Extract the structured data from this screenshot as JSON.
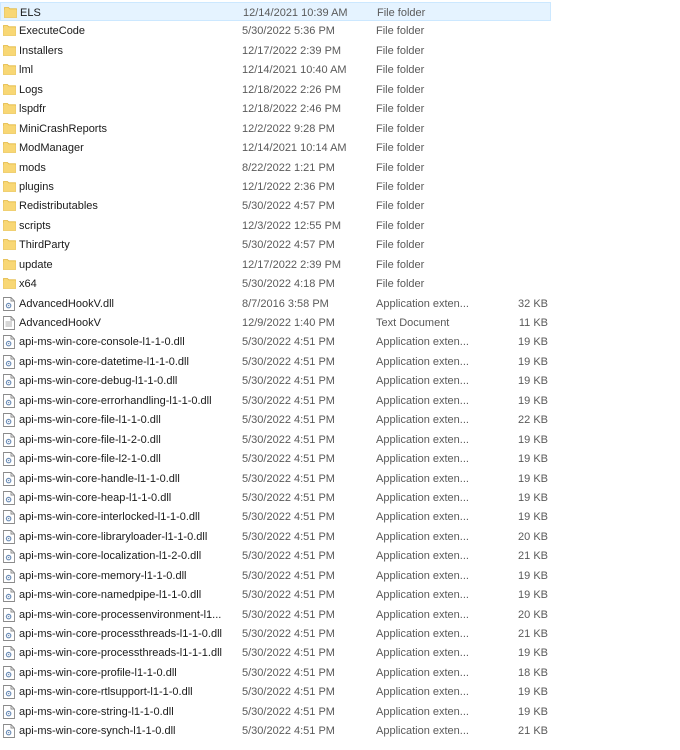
{
  "colors": {
    "folder": "#f8d775",
    "folder_dark": "#e2b73f",
    "selected_bg": "#e5f3ff",
    "selected_border": "#cce8ff",
    "secondary_text": "#5a5a5a"
  },
  "files": [
    {
      "name": "ELS",
      "date": "12/14/2021 10:39 AM",
      "type": "File folder",
      "size": "",
      "icon": "folder-icon",
      "selected": true
    },
    {
      "name": "ExecuteCode",
      "date": "5/30/2022 5:36 PM",
      "type": "File folder",
      "size": "",
      "icon": "folder-icon"
    },
    {
      "name": "Installers",
      "date": "12/17/2022 2:39 PM",
      "type": "File folder",
      "size": "",
      "icon": "folder-icon"
    },
    {
      "name": "lml",
      "date": "12/14/2021 10:40 AM",
      "type": "File folder",
      "size": "",
      "icon": "folder-icon"
    },
    {
      "name": "Logs",
      "date": "12/18/2022 2:26 PM",
      "type": "File folder",
      "size": "",
      "icon": "folder-icon"
    },
    {
      "name": "lspdfr",
      "date": "12/18/2022 2:46 PM",
      "type": "File folder",
      "size": "",
      "icon": "folder-icon"
    },
    {
      "name": "MiniCrashReports",
      "date": "12/2/2022 9:28 PM",
      "type": "File folder",
      "size": "",
      "icon": "folder-icon"
    },
    {
      "name": "ModManager",
      "date": "12/14/2021 10:14 AM",
      "type": "File folder",
      "size": "",
      "icon": "folder-icon"
    },
    {
      "name": "mods",
      "date": "8/22/2022 1:21 PM",
      "type": "File folder",
      "size": "",
      "icon": "folder-icon"
    },
    {
      "name": "plugins",
      "date": "12/1/2022 2:36 PM",
      "type": "File folder",
      "size": "",
      "icon": "folder-icon"
    },
    {
      "name": "Redistributables",
      "date": "5/30/2022 4:57 PM",
      "type": "File folder",
      "size": "",
      "icon": "folder-icon"
    },
    {
      "name": "scripts",
      "date": "12/3/2022 12:55 PM",
      "type": "File folder",
      "size": "",
      "icon": "folder-icon"
    },
    {
      "name": "ThirdParty",
      "date": "5/30/2022 4:57 PM",
      "type": "File folder",
      "size": "",
      "icon": "folder-icon"
    },
    {
      "name": "update",
      "date": "12/17/2022 2:39 PM",
      "type": "File folder",
      "size": "",
      "icon": "folder-icon"
    },
    {
      "name": "x64",
      "date": "5/30/2022 4:18 PM",
      "type": "File folder",
      "size": "",
      "icon": "folder-icon"
    },
    {
      "name": "AdvancedHookV.dll",
      "date": "8/7/2016 3:58 PM",
      "type": "Application exten...",
      "size": "32 KB",
      "icon": "dll-icon"
    },
    {
      "name": "AdvancedHookV",
      "date": "12/9/2022 1:40 PM",
      "type": "Text Document",
      "size": "11 KB",
      "icon": "text-document-icon"
    },
    {
      "name": "api-ms-win-core-console-l1-1-0.dll",
      "date": "5/30/2022 4:51 PM",
      "type": "Application exten...",
      "size": "19 KB",
      "icon": "dll-icon"
    },
    {
      "name": "api-ms-win-core-datetime-l1-1-0.dll",
      "date": "5/30/2022 4:51 PM",
      "type": "Application exten...",
      "size": "19 KB",
      "icon": "dll-icon"
    },
    {
      "name": "api-ms-win-core-debug-l1-1-0.dll",
      "date": "5/30/2022 4:51 PM",
      "type": "Application exten...",
      "size": "19 KB",
      "icon": "dll-icon"
    },
    {
      "name": "api-ms-win-core-errorhandling-l1-1-0.dll",
      "date": "5/30/2022 4:51 PM",
      "type": "Application exten...",
      "size": "19 KB",
      "icon": "dll-icon"
    },
    {
      "name": "api-ms-win-core-file-l1-1-0.dll",
      "date": "5/30/2022 4:51 PM",
      "type": "Application exten...",
      "size": "22 KB",
      "icon": "dll-icon"
    },
    {
      "name": "api-ms-win-core-file-l1-2-0.dll",
      "date": "5/30/2022 4:51 PM",
      "type": "Application exten...",
      "size": "19 KB",
      "icon": "dll-icon"
    },
    {
      "name": "api-ms-win-core-file-l2-1-0.dll",
      "date": "5/30/2022 4:51 PM",
      "type": "Application exten...",
      "size": "19 KB",
      "icon": "dll-icon"
    },
    {
      "name": "api-ms-win-core-handle-l1-1-0.dll",
      "date": "5/30/2022 4:51 PM",
      "type": "Application exten...",
      "size": "19 KB",
      "icon": "dll-icon"
    },
    {
      "name": "api-ms-win-core-heap-l1-1-0.dll",
      "date": "5/30/2022 4:51 PM",
      "type": "Application exten...",
      "size": "19 KB",
      "icon": "dll-icon"
    },
    {
      "name": "api-ms-win-core-interlocked-l1-1-0.dll",
      "date": "5/30/2022 4:51 PM",
      "type": "Application exten...",
      "size": "19 KB",
      "icon": "dll-icon"
    },
    {
      "name": "api-ms-win-core-libraryloader-l1-1-0.dll",
      "date": "5/30/2022 4:51 PM",
      "type": "Application exten...",
      "size": "20 KB",
      "icon": "dll-icon"
    },
    {
      "name": "api-ms-win-core-localization-l1-2-0.dll",
      "date": "5/30/2022 4:51 PM",
      "type": "Application exten...",
      "size": "21 KB",
      "icon": "dll-icon"
    },
    {
      "name": "api-ms-win-core-memory-l1-1-0.dll",
      "date": "5/30/2022 4:51 PM",
      "type": "Application exten...",
      "size": "19 KB",
      "icon": "dll-icon"
    },
    {
      "name": "api-ms-win-core-namedpipe-l1-1-0.dll",
      "date": "5/30/2022 4:51 PM",
      "type": "Application exten...",
      "size": "19 KB",
      "icon": "dll-icon"
    },
    {
      "name": "api-ms-win-core-processenvironment-l1...",
      "date": "5/30/2022 4:51 PM",
      "type": "Application exten...",
      "size": "20 KB",
      "icon": "dll-icon"
    },
    {
      "name": "api-ms-win-core-processthreads-l1-1-0.dll",
      "date": "5/30/2022 4:51 PM",
      "type": "Application exten...",
      "size": "21 KB",
      "icon": "dll-icon"
    },
    {
      "name": "api-ms-win-core-processthreads-l1-1-1.dll",
      "date": "5/30/2022 4:51 PM",
      "type": "Application exten...",
      "size": "19 KB",
      "icon": "dll-icon"
    },
    {
      "name": "api-ms-win-core-profile-l1-1-0.dll",
      "date": "5/30/2022 4:51 PM",
      "type": "Application exten...",
      "size": "18 KB",
      "icon": "dll-icon"
    },
    {
      "name": "api-ms-win-core-rtlsupport-l1-1-0.dll",
      "date": "5/30/2022 4:51 PM",
      "type": "Application exten...",
      "size": "19 KB",
      "icon": "dll-icon"
    },
    {
      "name": "api-ms-win-core-string-l1-1-0.dll",
      "date": "5/30/2022 4:51 PM",
      "type": "Application exten...",
      "size": "19 KB",
      "icon": "dll-icon"
    },
    {
      "name": "api-ms-win-core-synch-l1-1-0.dll",
      "date": "5/30/2022 4:51 PM",
      "type": "Application exten...",
      "size": "21 KB",
      "icon": "dll-icon"
    }
  ]
}
